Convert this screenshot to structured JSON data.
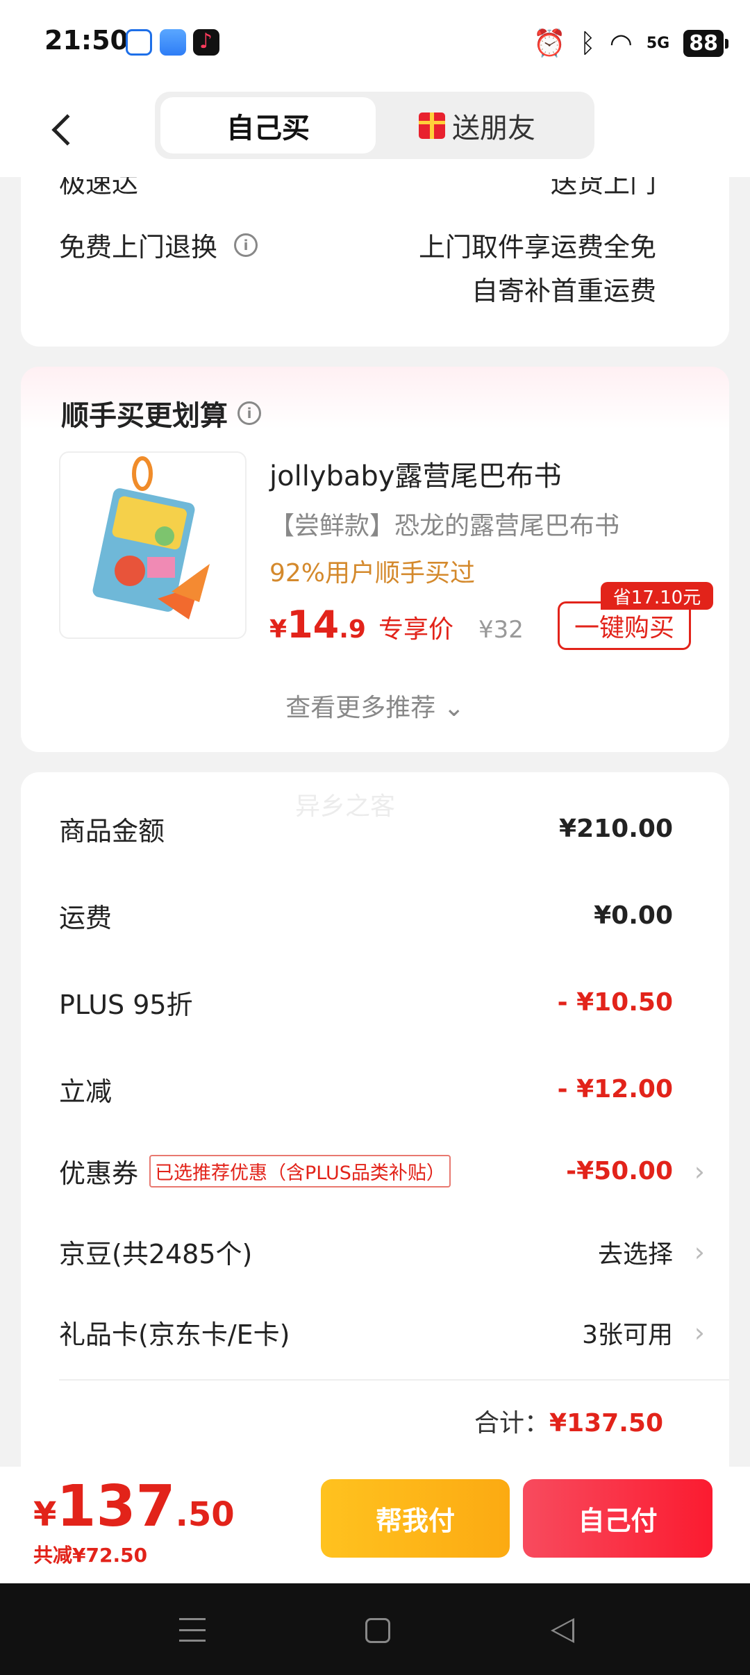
{
  "status": {
    "time": "21:50",
    "battery": "88",
    "network": "5G"
  },
  "tabs": {
    "self": "自己买",
    "gift": "送朋友"
  },
  "shipping": {
    "cut_left": "极速达",
    "cut_right": "送货上门",
    "free_return_label": "免费上门退换",
    "free_return_line1": "上门取件享运费全免",
    "free_return_line2": "自寄补首重运费"
  },
  "addon": {
    "title": "顺手买更划算",
    "product_name": "jollybaby露营尾巴布书",
    "product_sub": "【尝鲜款】恐龙的露营尾巴布书",
    "tag": "92%用户顺手买过",
    "price_yen": "¥",
    "price_int": "14",
    "price_dec": ".9",
    "price_label": "专享价",
    "orig_price": "¥32",
    "save_badge": "省17.10元",
    "buy_button": "一键购买",
    "more": "查看更多推荐 ⌄"
  },
  "summary": {
    "watermark": "异乡之客",
    "goods_label": "商品金额",
    "goods_value": "¥210.00",
    "freight_label": "运费",
    "freight_value": "¥0.00",
    "plus_label": "PLUS 95折",
    "plus_value": "- ¥10.50",
    "instant_label": "立减",
    "instant_value": "- ¥12.00",
    "coupon_label": "优惠券",
    "coupon_tag": "已选推荐优惠（含PLUS品类补贴）",
    "coupon_value": "-¥50.00",
    "beans_label": "京豆(共2485个)",
    "beans_value": "去选择",
    "giftcard_label": "礼品卡(京东卡/E卡)",
    "giftcard_value": "3张可用",
    "total_label": "合计：",
    "total_value": "¥137.50"
  },
  "bottom": {
    "yen": "¥",
    "price_int": "137",
    "price_dec": ".50",
    "saved": "共减¥72.50",
    "help_pay": "帮我付",
    "self_pay": "自己付"
  },
  "colors": {
    "accent_red": "#e2231a",
    "help_yellow": "#fcaa12",
    "tag_orange": "#d4892c"
  }
}
